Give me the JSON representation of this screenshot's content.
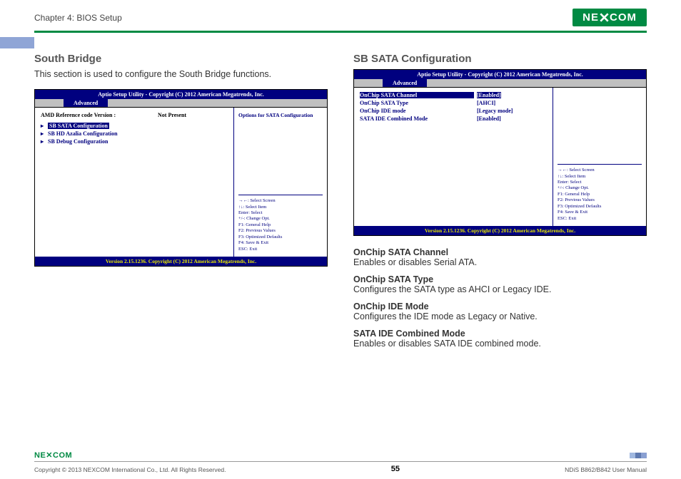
{
  "header": {
    "chapter": "Chapter 4: BIOS Setup",
    "logo_left": "NE",
    "logo_right": "COM"
  },
  "left": {
    "heading": "South Bridge",
    "intro": "This section is used to configure the South Bridge functions.",
    "bios": {
      "title": "Aptio Setup Utility - Copyright (C) 2012 American Megatrends, Inc.",
      "tab": "Advanced",
      "row1_label": "AMD Reference code Version :",
      "row1_val": "Not Present",
      "items": [
        "SB SATA Configuration",
        "SB HD Azalia Configuration",
        "SB Debug Configuration"
      ],
      "right_top": "Options for SATA Configuration",
      "help": "→←: Select Screen\n↑↓: Select Item\nEnter: Select\n+/-: Change Opt.\nF1: General Help\nF2: Previous Values\nF3: Optimized Defaults\nF4: Save & Exit\nESC: Exit",
      "footer": "Version 2.15.1236. Copyright (C) 2012 American Megatrends, Inc."
    }
  },
  "right": {
    "heading": "SB SATA Configuration",
    "bios": {
      "title": "Aptio Setup Utility - Copyright (C) 2012 American Megatrends, Inc.",
      "tab": "Advanced",
      "rows": [
        {
          "label": "OnChip SATA Channel",
          "val": "[Enabled]"
        },
        {
          "label": "OnChip SATA Type",
          "val": "[AHCI]"
        },
        {
          "label": "OnChip IDE mode",
          "val": "[Legacy mode]"
        },
        {
          "label": "SATA IDE Combined Mode",
          "val": "[Enabled]"
        }
      ],
      "help": "→←: Select Screen\n↑↓: Select Item\nEnter: Select\n+/-: Change Opt.\nF1: General Help\nF2: Previous Values\nF3: Optimized Defaults\nF4: Save & Exit\nESC: Exit",
      "footer": "Version 2.15.1236. Copyright (C) 2012 American Megatrends, Inc."
    },
    "options": [
      {
        "t": "OnChip SATA Channel",
        "d": "Enables or disables Serial ATA."
      },
      {
        "t": "OnChip SATA Type",
        "d": "Configures the SATA type as AHCI or Legacy IDE."
      },
      {
        "t": "OnChip IDE Mode",
        "d": "Configures the IDE mode as Legacy or Native."
      },
      {
        "t": "SATA IDE Combined Mode",
        "d": "Enables or disables SATA IDE combined mode."
      }
    ]
  },
  "footer": {
    "copyright": "Copyright © 2013 NEXCOM International Co., Ltd. All Rights Reserved.",
    "page": "55",
    "right": "NDiS B862/B842 User Manual"
  }
}
